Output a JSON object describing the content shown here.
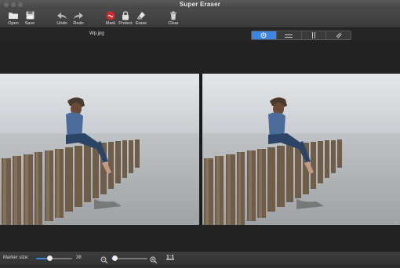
{
  "window": {
    "title": "Super Eraser"
  },
  "toolbar": {
    "items": [
      {
        "label": "Open",
        "icon": "folder-icon"
      },
      {
        "label": "Save",
        "icon": "floppy-icon"
      },
      {
        "label": "Undo",
        "icon": "undo-arrow-icon"
      },
      {
        "label": "Redo",
        "icon": "redo-arrow-icon"
      },
      {
        "label": "Mark",
        "icon": "red-marker-icon"
      },
      {
        "label": "Protect",
        "icon": "lock-icon"
      },
      {
        "label": "Erase",
        "icon": "eraser-icon"
      },
      {
        "label": "Clear",
        "icon": "trash-icon"
      }
    ]
  },
  "file": {
    "name": "Wp.jpg"
  },
  "view_modes": [
    {
      "icon": "target-icon",
      "active": true
    },
    {
      "icon": "horizontal-split-icon",
      "active": false
    },
    {
      "icon": "vertical-split-icon",
      "active": false
    },
    {
      "icon": "diagonal-split-icon",
      "active": false
    }
  ],
  "status": {
    "marker_label": "Marker size:",
    "marker_value": "38",
    "marker_level": 0.38,
    "zoom_level": 0.1,
    "ratio_label": "1:1"
  },
  "colors": {
    "accent": "#3b86e0",
    "mark": "#d9262b"
  }
}
